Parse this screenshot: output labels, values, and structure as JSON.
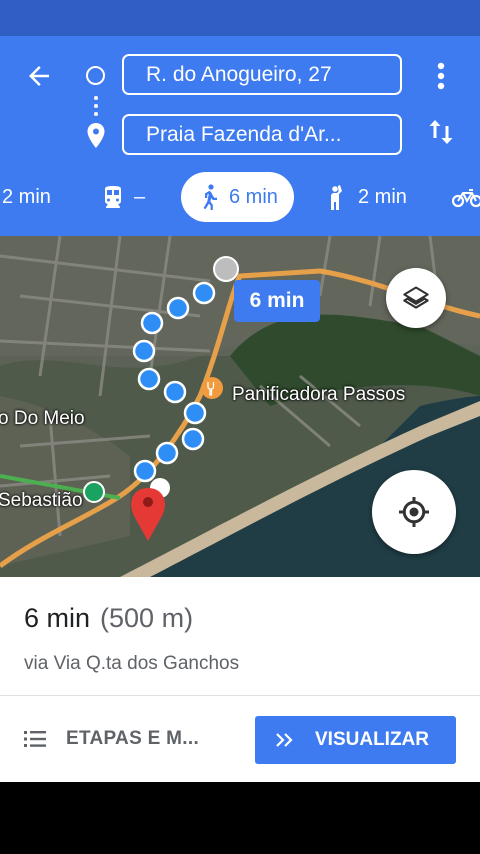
{
  "colors": {
    "primary": "#3e7bf0",
    "status_bar": "#2f5fc2",
    "route_dot": "#2f8ef6",
    "destination_pin": "#e53935"
  },
  "header": {
    "back_icon": "arrow-left-icon",
    "origin": "R. do Anogueiro, 27",
    "destination": "Praia Fazenda d'Ar...",
    "more_icon": "more-vert-icon",
    "swap_icon": "swap-vert-icon"
  },
  "modes": [
    {
      "name": "drive",
      "label": "2 min",
      "icon": "car-icon"
    },
    {
      "name": "transit",
      "label": "–",
      "icon": "train-icon"
    },
    {
      "name": "walk",
      "label": "6 min",
      "icon": "walk-icon",
      "selected": true
    },
    {
      "name": "ride",
      "label": "2 min",
      "icon": "hail-icon"
    },
    {
      "name": "bike",
      "label": "",
      "icon": "bike-icon"
    }
  ],
  "map": {
    "route_time": "6 min",
    "poi": "Panificadora Passos",
    "street_label": "o Do Meio",
    "place_label": "Sebastião",
    "layers_icon": "layers-icon",
    "locate_icon": "my-location-icon"
  },
  "sheet": {
    "duration": "6 min",
    "distance": "(500 m)",
    "via": "via Via Q.ta dos Ganchos",
    "steps_label": "ETAPAS E M...",
    "visualize_label": "VISUALIZAR"
  }
}
